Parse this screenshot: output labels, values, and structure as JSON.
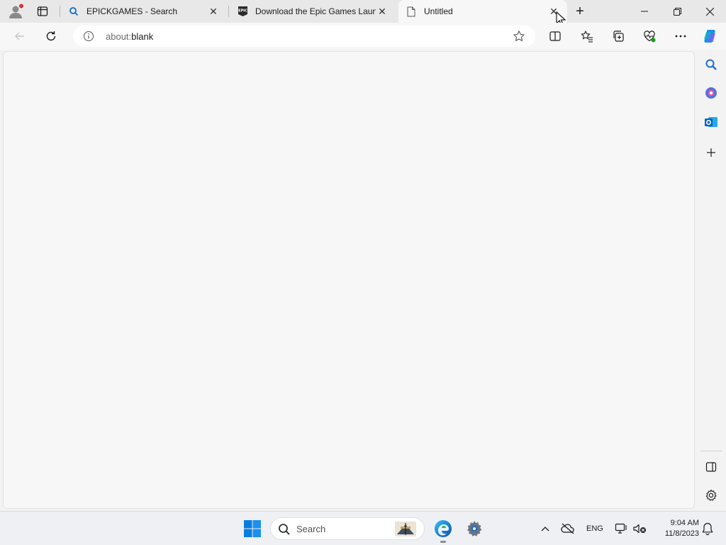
{
  "browser": {
    "tabs": [
      {
        "title": "EPICKGAMES - Search",
        "icon": "search-icon",
        "close": "✕"
      },
      {
        "title": "Download the Epic Games Launcher",
        "icon": "epic-games-icon",
        "close": "✕"
      },
      {
        "title": "Untitled",
        "icon": "blank-page-icon",
        "close": "✕",
        "active": true
      }
    ],
    "new_tab": "+",
    "address": {
      "prefix": "about:",
      "value": "blank"
    },
    "accent_color": "#0078d4"
  },
  "taskbar": {
    "search_placeholder": "Search",
    "language": "ENG",
    "time": "9:04 AM",
    "date": "11/8/2023"
  }
}
